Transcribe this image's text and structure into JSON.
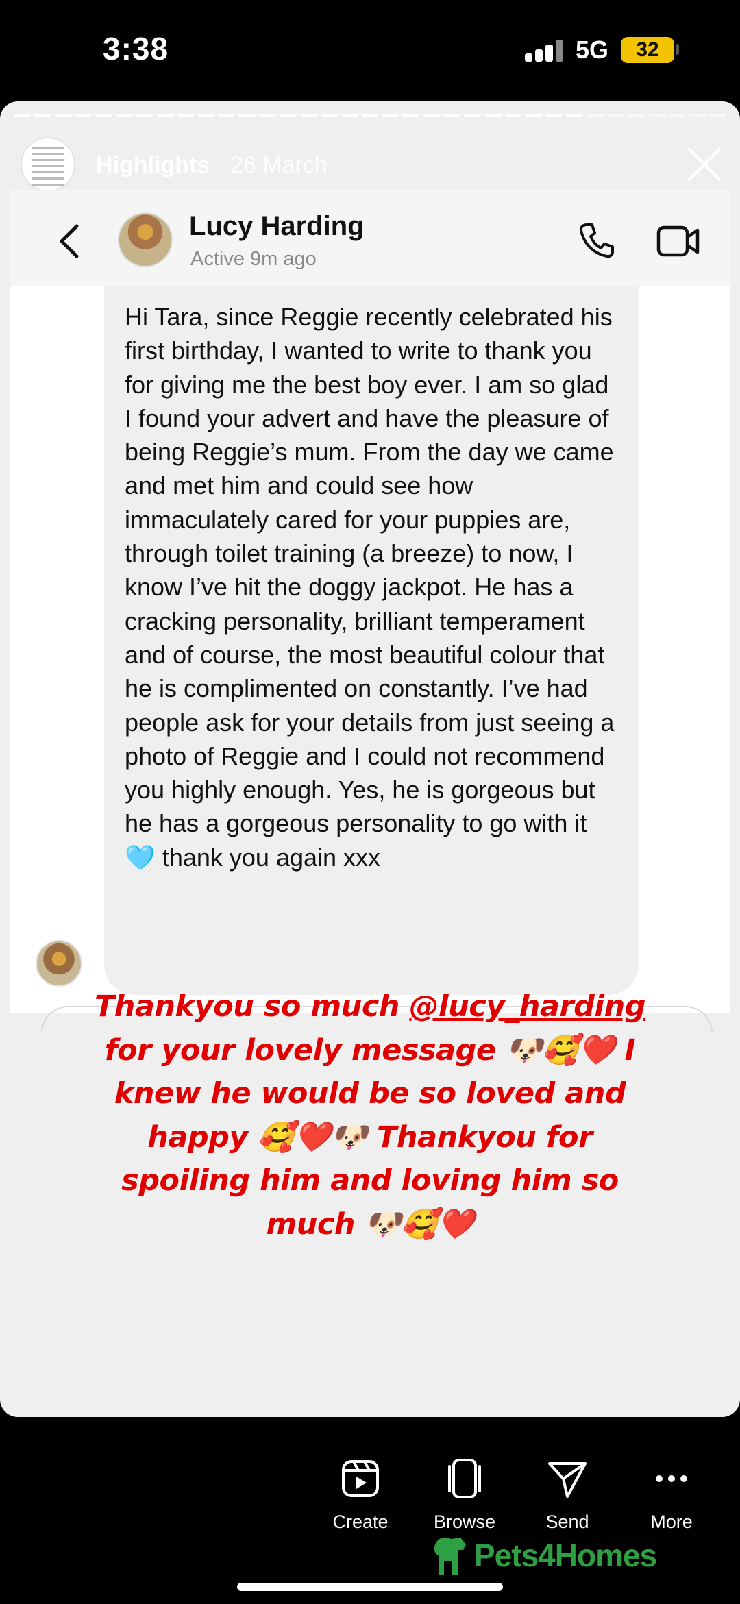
{
  "status_bar": {
    "time": "3:38",
    "network": "5G",
    "battery": "32"
  },
  "story": {
    "title": "Highlights",
    "date": "26 March"
  },
  "chat": {
    "contact_name": "Lucy Harding",
    "contact_status": "Active 9m ago",
    "message": "Hi Tara, since Reggie recently celebrated his first birthday, I wanted to write to thank you for giving me the best boy ever. I am so glad I found your advert and have the pleasure of being Reggie’s mum. From the day we came and met him and could see how immaculately cared for your puppies are, through toilet training (a breeze) to now, I know I’ve hit the doggy jackpot. He has a cracking personality, brilliant temperament and of course, the most beautiful colour that he is complimented on constantly. I’ve had people ask for your details from just seeing a photo of Reggie and I could not recommend you highly enough. Yes, he is gorgeous but he has a gorgeous personality to go with it",
    "message_emoji": "🩵",
    "message_end": "thank you again xxx"
  },
  "caption": {
    "part1": "Thankyou so much",
    "mention": "@lucy_harding",
    "part2": "for your lovely message 🐶🥰❤️ I knew he would be so loved and happy 🥰❤️🐶 Thankyou for spoiling him and loving him so much 🐶🥰❤️"
  },
  "actions": [
    {
      "label": "Create",
      "icon": "create-icon"
    },
    {
      "label": "Browse",
      "icon": "browse-icon"
    },
    {
      "label": "Send",
      "icon": "send-icon"
    },
    {
      "label": "More",
      "icon": "more-icon"
    }
  ],
  "watermark": {
    "text": "Pets4Homes",
    "icon": "dog-icon"
  },
  "colors": {
    "caption": "#e00000",
    "battery": "#f3c300",
    "watermark": "#2ea043",
    "heart": "#7fd0ef"
  }
}
